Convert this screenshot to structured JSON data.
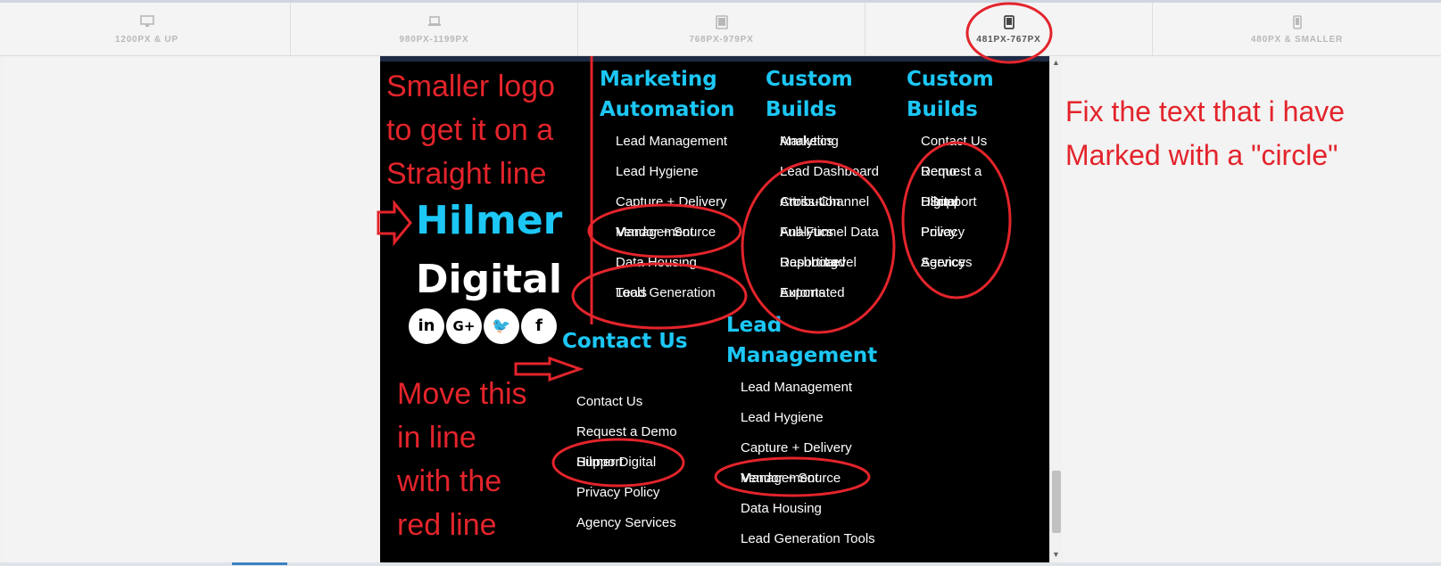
{
  "breakpoints": [
    {
      "label": "1200PX & UP",
      "icon": "desktop-icon"
    },
    {
      "label": "980PX-1199PX",
      "icon": "laptop-icon"
    },
    {
      "label": "768PX-979PX",
      "icon": "tablet-icon"
    },
    {
      "label": "481PX-767PX",
      "icon": "phone-landscape-icon"
    },
    {
      "label": "480PX & SMALLER",
      "icon": "phone-icon"
    }
  ],
  "logo": {
    "line1": "Hilmer",
    "line2": "Digital"
  },
  "social": [
    "in",
    "G+",
    "🐦",
    "f"
  ],
  "columns": {
    "marketing": {
      "heading": [
        "Marketing",
        "Automation"
      ],
      "links": [
        "Lead Management",
        "Lead Hygiene",
        "Capture + Delivery",
        "Vendor + Source",
        "Management",
        "Data Housing",
        "Lead Generation",
        "Tools"
      ]
    },
    "custom1": {
      "heading": [
        "Custom",
        "Builds"
      ],
      "links": [
        "Marketing",
        "Analytics",
        "Lead Dashboard",
        "Cross-Channel",
        "Attribution",
        "Full-Funnel Data",
        "Analytics",
        "Reporting",
        "Dashboard",
        "Level",
        "Automated",
        "Exports"
      ]
    },
    "custom2": {
      "heading": [
        "Custom",
        "Builds"
      ],
      "links": [
        "Contact Us",
        "Request a",
        "Demo",
        "Hilmer",
        "Digital",
        "Support",
        "Privacy",
        "Policy",
        "Agency",
        "Services"
      ]
    },
    "contact": {
      "heading": "Contact Us",
      "links": [
        "Contact Us",
        "Request a Demo",
        "Hilmer Digital",
        "Support",
        "Privacy Policy",
        "Agency Services"
      ]
    },
    "leadmgmt": {
      "heading": [
        "Lead",
        "Management"
      ],
      "links": [
        "Lead Management",
        "Lead Hygiene",
        "Capture + Delivery",
        "Vendor + Source",
        "Management",
        "Data Housing",
        "Lead Generation Tools"
      ]
    }
  },
  "annotations": {
    "logo_note": [
      "Smaller logo",
      "to get it on a",
      "Straight line"
    ],
    "move_note": [
      "Move this",
      "in line",
      "with the",
      "red line"
    ],
    "fix_note": [
      "Fix the text that i have",
      "Marked with a \"circle\""
    ]
  },
  "colors": {
    "accent": "#1cc7f5",
    "annotation": "#e3242b",
    "footer_bg": "#000000"
  }
}
